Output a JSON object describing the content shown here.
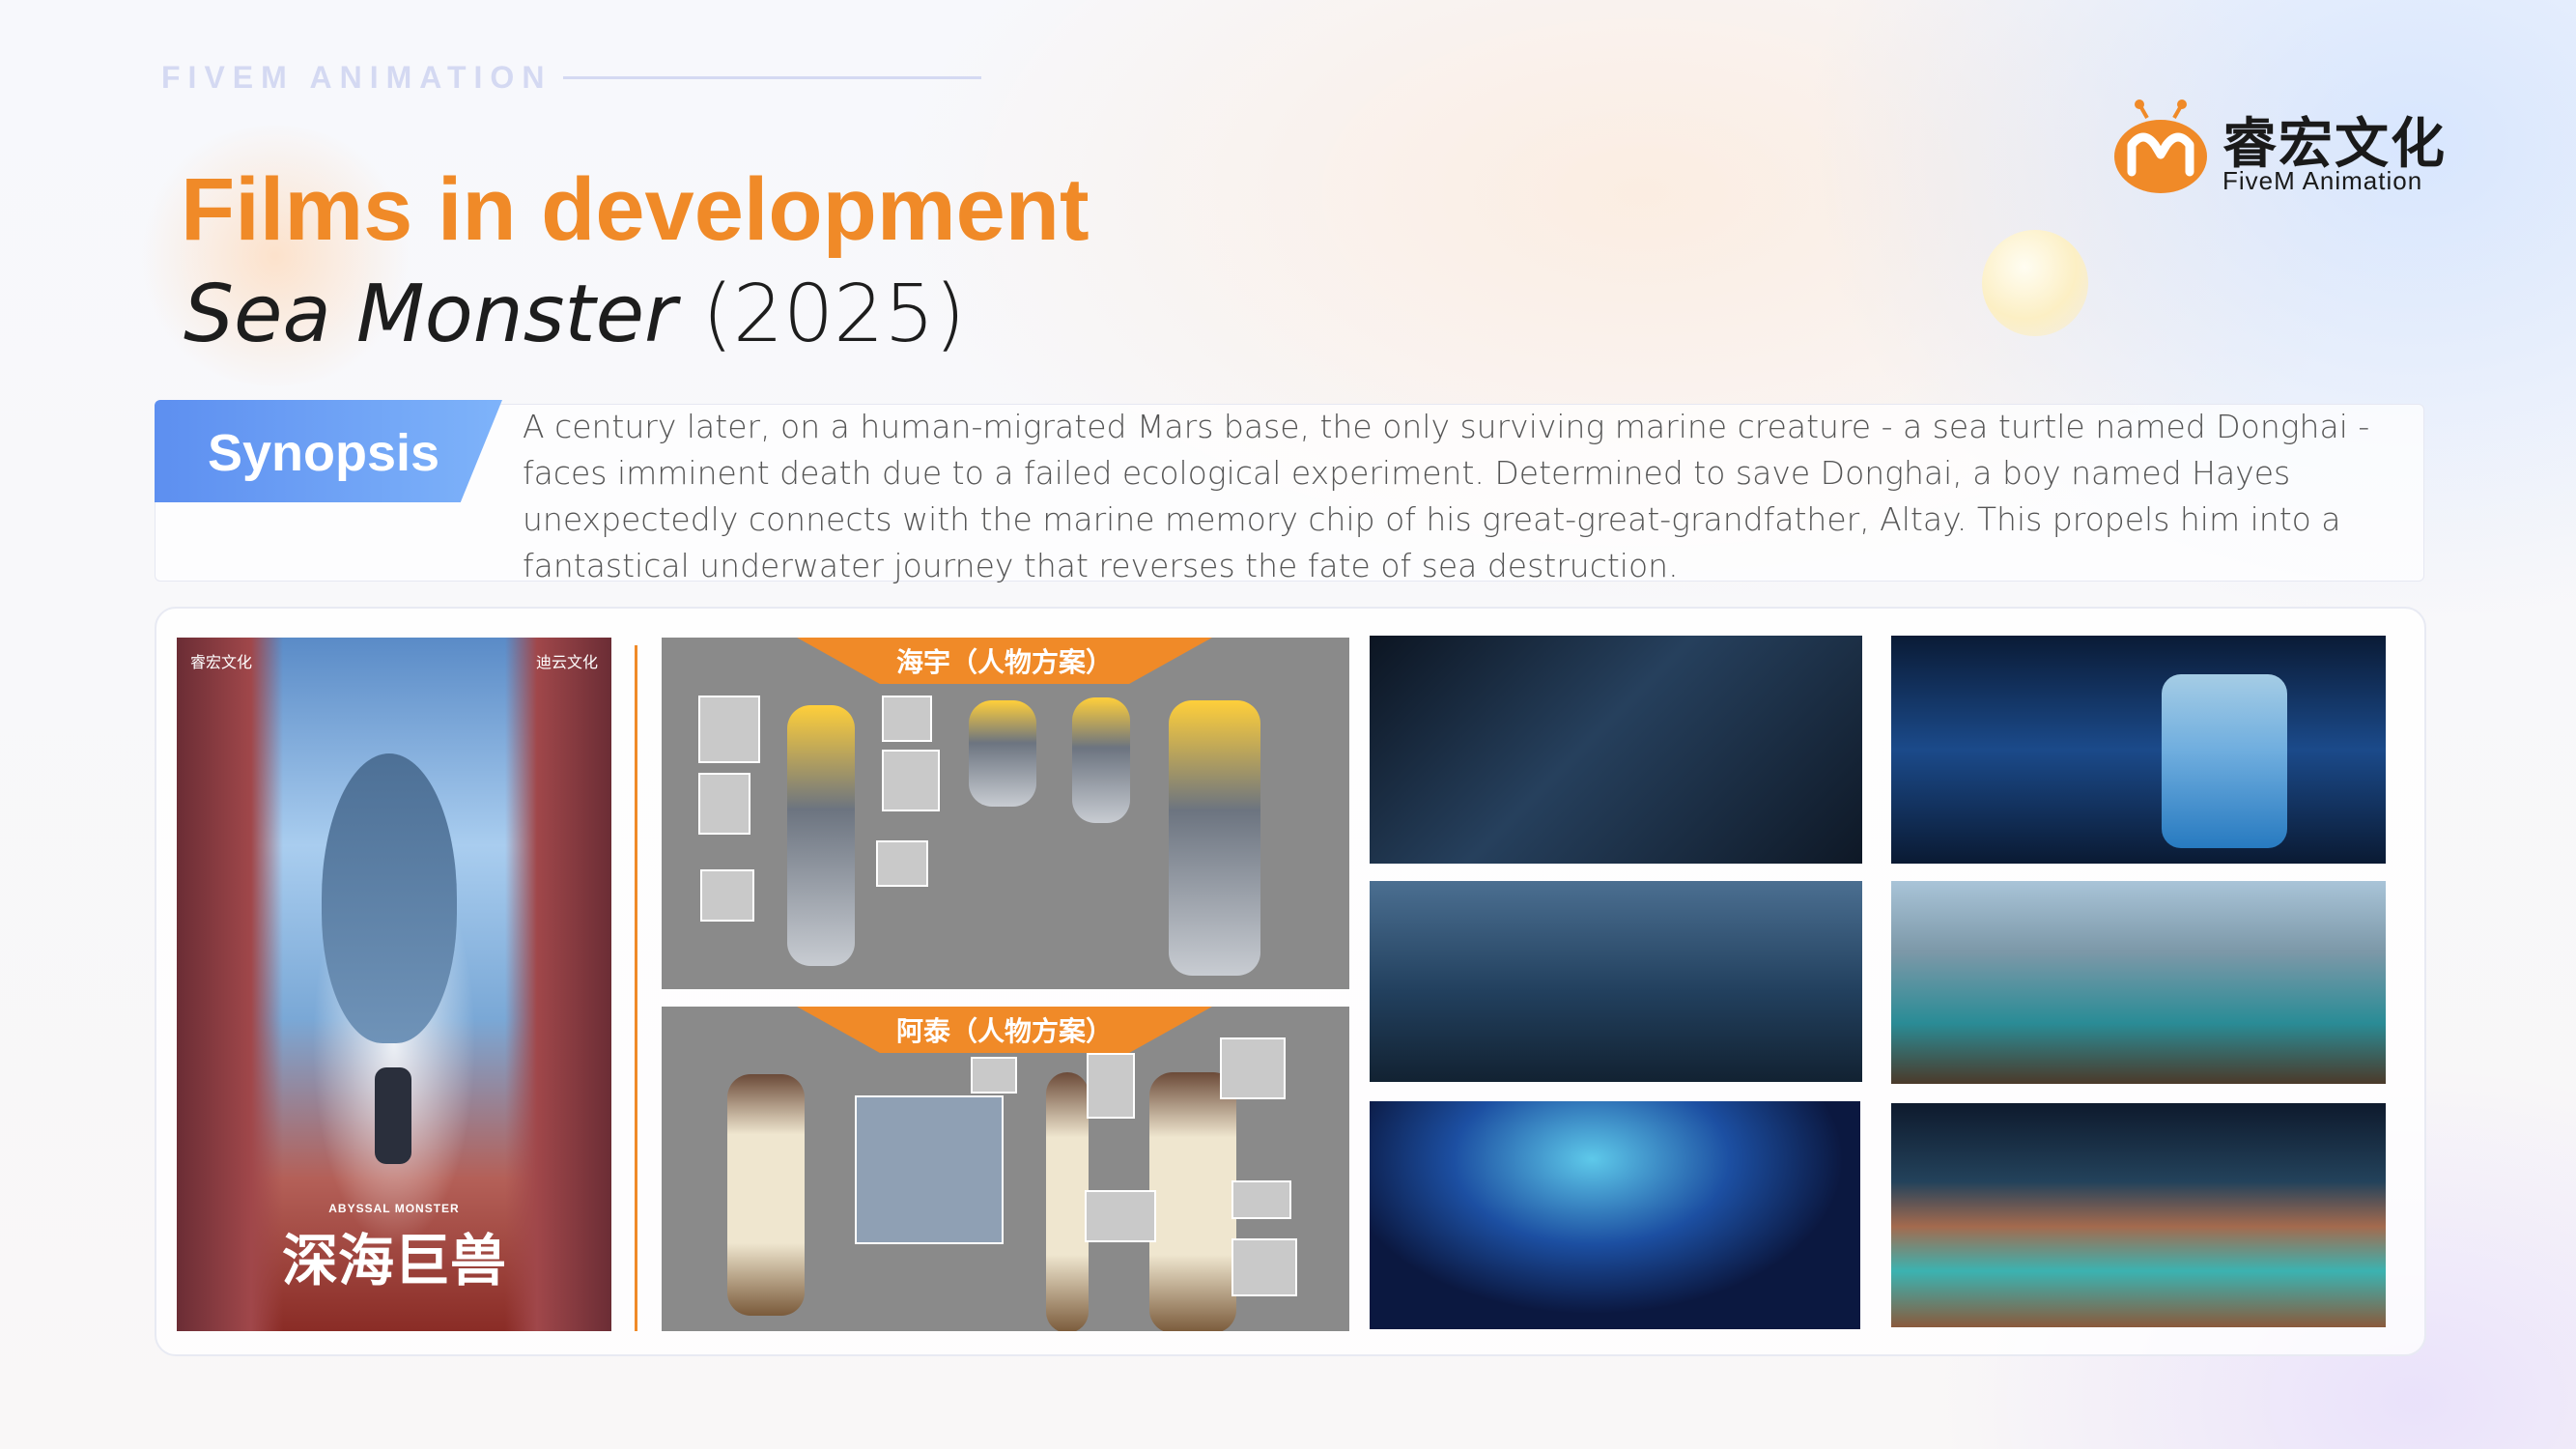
{
  "header": {
    "eyebrow": "FIVEM ANIMATION",
    "title": "Films in development",
    "film_title": "Sea Monster",
    "film_year": "(2025)"
  },
  "logo": {
    "chinese_name": "睿宏文化",
    "english_name": "FiveM Animation",
    "icon": "fivem-logo-icon",
    "accent_color": "#f08a28"
  },
  "synopsis": {
    "label": "Synopsis",
    "text": "A century later, on a human-migrated Mars base, the only surviving marine creature - a sea turtle named Donghai - faces imminent death due to a failed ecological experiment. Determined to save Donghai, a boy named Hayes unexpectedly connects with the marine memory chip of his great-great-grandfather, Altay. This propels him into a fantastical underwater journey that reverses the fate of sea destruction."
  },
  "gallery": {
    "poster": {
      "title": "深海巨兽",
      "tagline": "ABYSSAL MONSTER",
      "studio_left": "睿宏文化",
      "studio_right": "迪云文化"
    },
    "character_sheets": [
      {
        "label": "海宇（人物方案）"
      },
      {
        "label": "阿泰（人物方案）"
      }
    ]
  },
  "colors": {
    "title_orange": "#f08a28",
    "tag_blue": "#5d8ff0"
  }
}
